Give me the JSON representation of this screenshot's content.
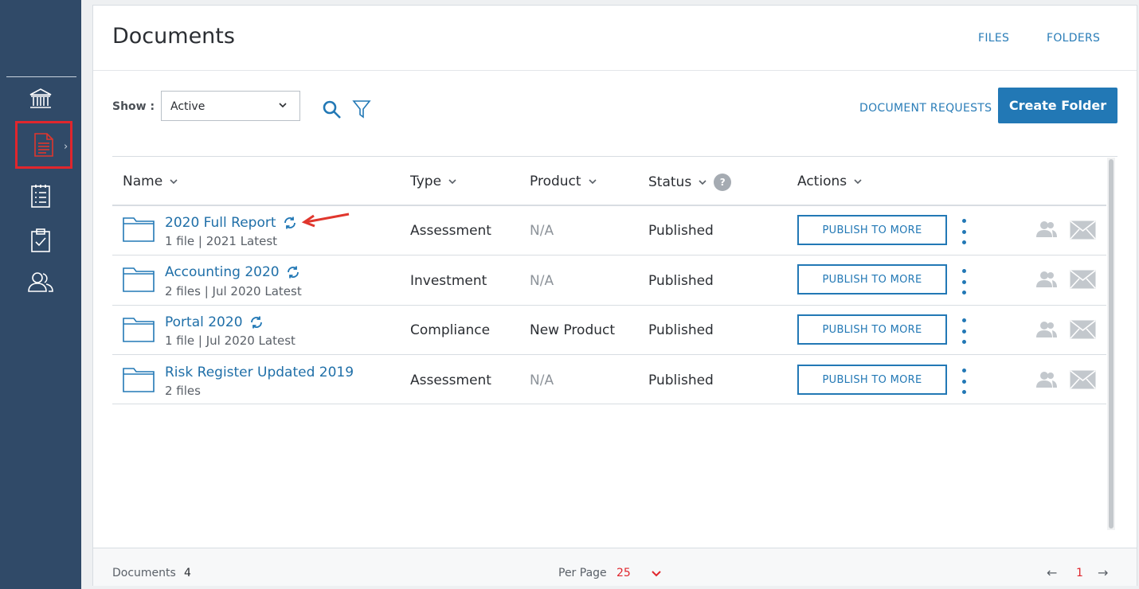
{
  "page": {
    "title": "Documents"
  },
  "top_tabs": [
    {
      "label": "FILES"
    },
    {
      "label": "FOLDERS"
    }
  ],
  "sidebar": {
    "items": [
      {
        "icon": "bank-icon"
      },
      {
        "icon": "document-icon",
        "active": true
      },
      {
        "icon": "checklist-icon"
      },
      {
        "icon": "clipboard-check-icon"
      },
      {
        "icon": "users-icon"
      }
    ]
  },
  "toolbar": {
    "show_label": "Show :",
    "show_value": "Active",
    "document_requests": "DOCUMENT REQUESTS",
    "create_folder": "Create Folder"
  },
  "table": {
    "columns": [
      "Name",
      "Type",
      "Product",
      "Status",
      "Actions"
    ],
    "status_help": "?",
    "rows": [
      {
        "name": "2020 Full Report",
        "meta": "1 file | 2021 Latest",
        "type": "Assessment",
        "product": "N/A",
        "status": "Published",
        "action": "PUBLISH TO MORE",
        "sync": true
      },
      {
        "name": "Accounting 2020",
        "meta": "2 files | Jul 2020 Latest",
        "type": "Investment",
        "product": "N/A",
        "status": "Published",
        "action": "PUBLISH TO MORE",
        "sync": true
      },
      {
        "name": "Portal 2020",
        "meta": "1 file | Jul 2020 Latest",
        "type": "Compliance",
        "product": "New Product",
        "status": "Published",
        "action": "PUBLISH TO MORE",
        "sync": true
      },
      {
        "name": "Risk Register Updated 2019",
        "meta": "2 files",
        "type": "Assessment",
        "product": "N/A",
        "status": "Published",
        "action": "PUBLISH TO MORE",
        "sync": false
      }
    ]
  },
  "footer": {
    "documents_label": "Documents",
    "documents_count": "4",
    "per_page_label": "Per Page",
    "per_page_value": "25",
    "prev": "←",
    "page": "1",
    "next": "→"
  },
  "colors": {
    "accent": "#2278b5",
    "sidebar": "#304a68",
    "highlight": "#e0262d"
  }
}
